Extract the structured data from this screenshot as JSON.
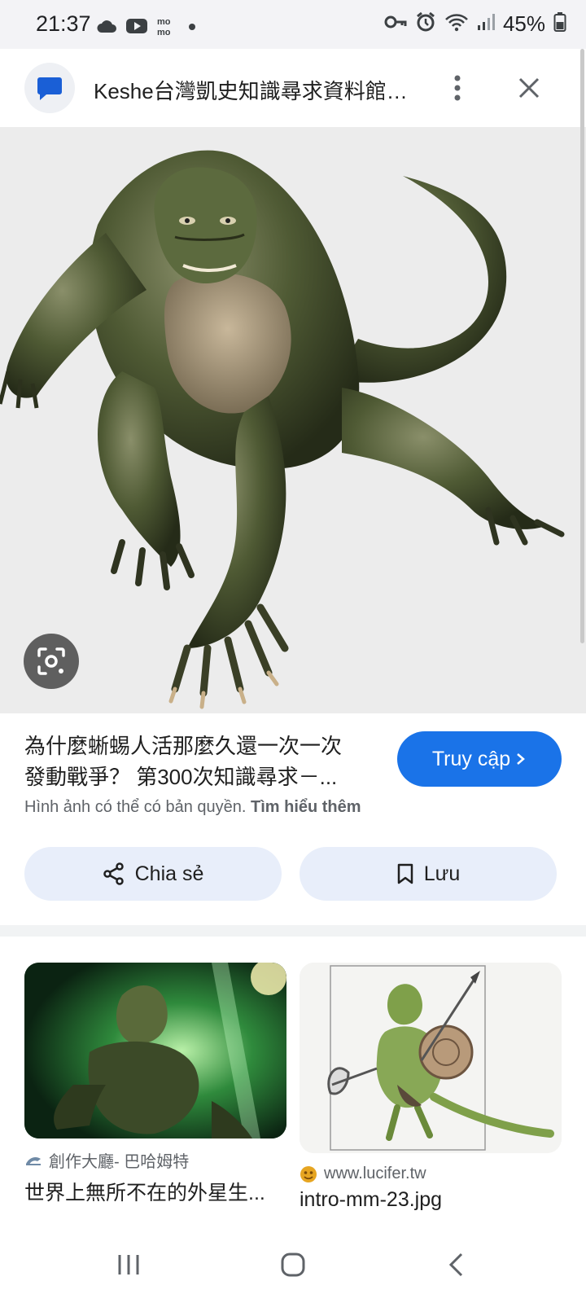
{
  "status_bar": {
    "time": "21:37",
    "left_icons": [
      "cloud-icon",
      "youtube-icon",
      "momo-icon",
      "dot-icon"
    ],
    "right_icons": [
      "vpn-key-icon",
      "alarm-icon",
      "wifi-icon",
      "signal-icon",
      "battery-icon"
    ],
    "battery": "45%"
  },
  "header": {
    "title": "Keshe台灣凱史知識尋求資料館- ..."
  },
  "result": {
    "title_line1": "為什麼蜥蜴人活那麼久還一次一次",
    "title_line2": "發動戰爭？ 第300次知識尋求－...",
    "visit_label": "Truy cập",
    "copyright_text": "Hình ảnh có thể có bản quyền.",
    "learn_more": "Tìm hiểu thêm",
    "share_label": "Chia sẻ",
    "save_label": "Lưu"
  },
  "related": [
    {
      "source": "創作大廳- 巴哈姆特",
      "caption": "世界上無所不在的外星生..."
    },
    {
      "source": "www.lucifer.tw",
      "caption": "intro-mm-23.jpg"
    }
  ],
  "colors": {
    "accent": "#1a73e8",
    "chip_bg": "#e8eefa"
  }
}
